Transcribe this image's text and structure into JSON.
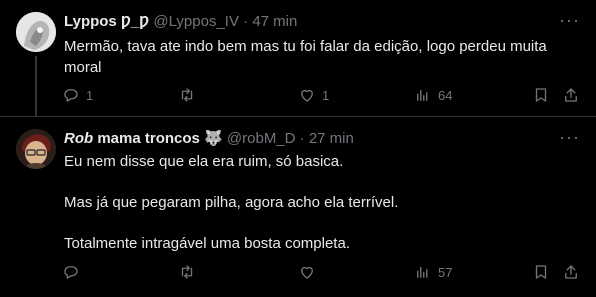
{
  "tweets": [
    {
      "author": {
        "name": "Lyppos Ƿ_Ƿ",
        "handle": "@Lyppos_IV"
      },
      "separator": "·",
      "time": "47 min",
      "text_lines": [
        "Mermão, tava ate indo bem mas tu foi falar da edição, logo perdeu muita moral"
      ],
      "actions": {
        "replies": "1",
        "retweets": "",
        "likes": "1",
        "views": "64"
      },
      "icons": [
        "reply-icon",
        "retweet-icon",
        "like-icon",
        "views-icon",
        "bookmark-icon",
        "share-icon"
      ]
    },
    {
      "author": {
        "name_italic": "Rob",
        "name_rest": " mama troncos",
        "badge": "🐺",
        "handle": "@robM_D"
      },
      "separator": "·",
      "time": "27 min",
      "text_lines": [
        "Eu nem disse que ela era ruim, só basica.",
        "Mas já que pegaram pilha, agora acho ela terrível.",
        "Totalmente intragável uma bosta completa."
      ],
      "actions": {
        "replies": "",
        "retweets": "",
        "likes": "",
        "views": "57"
      },
      "icons": [
        "reply-icon",
        "retweet-icon",
        "like-icon",
        "views-icon",
        "bookmark-icon",
        "share-icon"
      ]
    }
  ],
  "colors": {
    "background": "#000000",
    "text": "#e7e9ea",
    "secondary": "#71767b",
    "divider": "#2f3336"
  }
}
